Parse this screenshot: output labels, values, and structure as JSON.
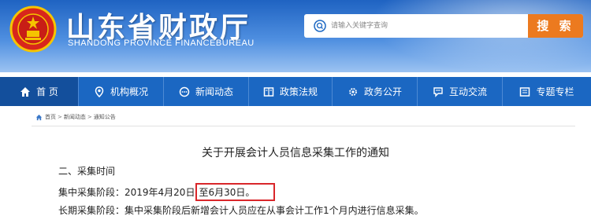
{
  "header": {
    "title": "山东省财政厅",
    "subtitle": "SHANDONG PROVINCE FINANCEBUREAU",
    "search": {
      "placeholder": "请输入关键字查询",
      "button_label": "搜 索"
    },
    "colors": {
      "primary": "#1b67c2",
      "accent": "#ec7a1f",
      "highlight": "#d9262a"
    }
  },
  "nav": {
    "items": [
      {
        "label": "首  页",
        "icon": "home-icon"
      },
      {
        "label": "机构概况",
        "icon": "location-icon"
      },
      {
        "label": "新闻动态",
        "icon": "chat-icon"
      },
      {
        "label": "政策法规",
        "icon": "book-icon"
      },
      {
        "label": "政务公开",
        "icon": "gear-icon"
      },
      {
        "label": "互动交流",
        "icon": "comment-icon"
      },
      {
        "label": "专题专栏",
        "icon": "folder-icon"
      }
    ]
  },
  "breadcrumb": {
    "items": [
      "首页",
      "新闻动态",
      "通知公告"
    ],
    "separator": ">"
  },
  "article": {
    "title": "关于开展会计人员信息采集工作的通知",
    "section_heading": "二、采集时间",
    "line1_prefix": "集中采集阶段：2019年4月20日",
    "line1_highlight": "至6月30日。",
    "line2": "长期采集阶段：集中采集阶段后新增会计人员应在从事会计工作1个月内进行信息采集。"
  }
}
